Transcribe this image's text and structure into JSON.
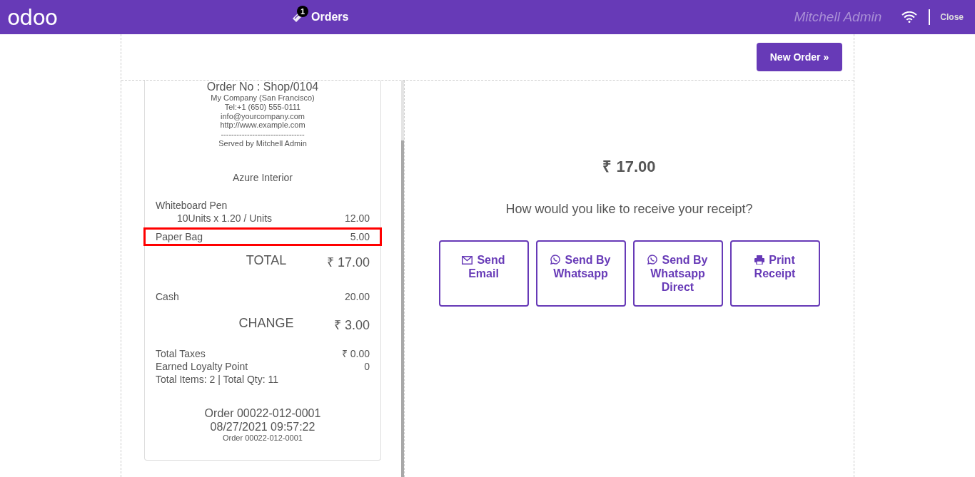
{
  "header": {
    "logo": "odoo",
    "orders_label": "Orders",
    "orders_badge": "1",
    "user": "Mitchell Admin",
    "close": "Close"
  },
  "new_order": {
    "label": "New Order",
    "arrow": "»"
  },
  "receipt": {
    "order_no": "Order No : Shop/0104",
    "company_lines": [
      "My Company (San Francisco)",
      "Tel:+1 (650) 555-0111",
      "info@yourcompany.com",
      "http://www.example.com",
      "--------------------------------",
      "Served by Mitchell Admin"
    ],
    "customer": "Azure Interior",
    "lines": [
      {
        "name": "Whiteboard Pen",
        "detail": "10Units x 1.20 / Units",
        "amount": "12.00",
        "highlighted": false
      },
      {
        "name": "Paper Bag",
        "amount": "5.00",
        "highlighted": true
      }
    ],
    "total_label": "TOTAL",
    "total": "₹ 17.00",
    "payments": [
      {
        "name": "Cash",
        "amount": "20.00"
      }
    ],
    "change_label": "CHANGE",
    "change": "₹ 3.00",
    "summary": [
      {
        "label": "Total Taxes",
        "value": "₹ 0.00"
      },
      {
        "label": "Earned Loyalty Point",
        "value": "0"
      },
      {
        "label": "Total Items: 2 | Total Qty: 11"
      }
    ],
    "footer": [
      "Order 00022-012-0001",
      "08/27/2021 09:57:22"
    ],
    "footer_small": "Order 00022-012-0001"
  },
  "amount": "₹ 17.00",
  "question": "How would you like to receive your receipt?",
  "actions": [
    {
      "kind": "email",
      "label": "Send Email"
    },
    {
      "kind": "whatsapp",
      "label": "Send By Whatsapp"
    },
    {
      "kind": "whatsapp",
      "label": "Send By Whatsapp Direct"
    },
    {
      "kind": "print",
      "label": "Print Receipt"
    }
  ]
}
